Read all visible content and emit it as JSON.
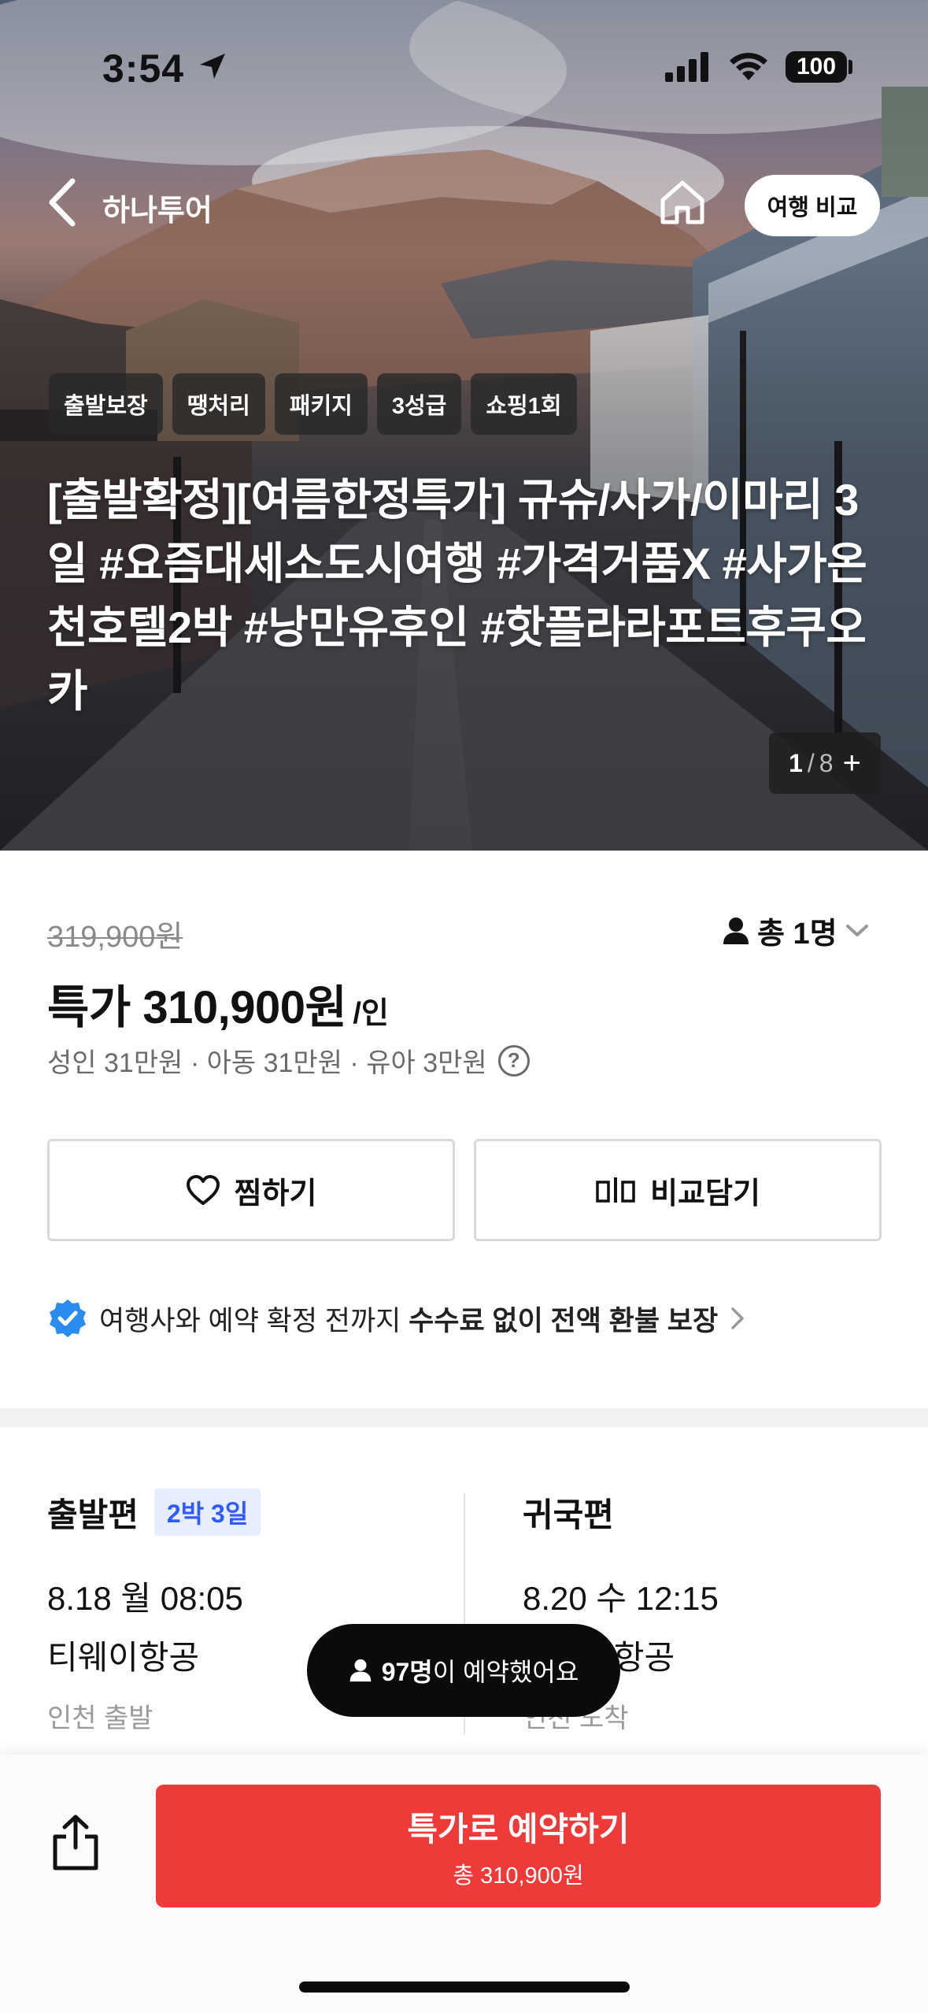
{
  "status_bar": {
    "time": "3:54",
    "battery": "100"
  },
  "nav": {
    "back_label": "하나투어",
    "compare_label": "여행 비교"
  },
  "hero": {
    "tags": [
      "출발보장",
      "땡처리",
      "패키지",
      "3성급",
      "쇼핑1회"
    ],
    "title": "[출발확정][여름한정특가] 규슈/사가/이마리 3일 #요즘대세소도시여행 #가격거품X #사가온천호텔2박 #낭만유후인 #핫플라라포트후쿠오카",
    "image_counter": {
      "current": "1",
      "separator": "/",
      "total": "8",
      "more": "+"
    }
  },
  "price": {
    "original": "319,900원",
    "pax_label": "총 1명",
    "special": "특가 310,900원",
    "per_unit": "/인",
    "breakdown": "성인 31만원 · 아동 31만원 · 유아 3만원",
    "help": "?"
  },
  "actions": {
    "wish_label": "찜하기",
    "compare_label": "비교담기"
  },
  "refund": {
    "prefix": "여행사와 예약 확정 전까지 ",
    "emphasis": "수수료 없이 전액 환불 보장"
  },
  "flights": {
    "departure": {
      "title": "출발편",
      "badge": "2박 3일",
      "datetime": "8.18 월 08:05",
      "airline": "티웨이항공",
      "airport": "인천 출발"
    },
    "return": {
      "title": "귀국편",
      "datetime": "8.20 수 12:15",
      "airline": "티웨이항공",
      "airport": "인천 도착"
    }
  },
  "booked_toast": {
    "count": "97명",
    "suffix": "이 예약했어요"
  },
  "cta": {
    "main": "특가로 예약하기",
    "sub": "총 310,900원"
  },
  "colors": {
    "cta": "#ef3a3a",
    "badge_bg": "#e6eeff",
    "badge_text": "#2f5bff",
    "verified": "#2b8cf0"
  }
}
